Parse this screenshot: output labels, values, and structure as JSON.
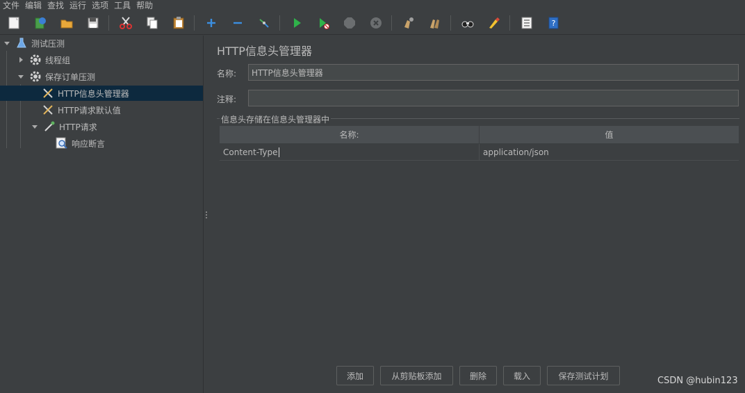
{
  "menu": [
    "文件",
    "编辑",
    "查找",
    "运行",
    "选项",
    "工具",
    "帮助"
  ],
  "toolbar_icons": [
    "new-icon",
    "templates-icon",
    "open-icon",
    "save-icon",
    "cut-icon",
    "copy-icon",
    "paste-icon",
    "expand-icon",
    "collapse-icon",
    "toggle-icon",
    "start-icon",
    "start-no-pause-icon",
    "stop-icon",
    "shutdown-icon",
    "clear-icon",
    "clear-all-icon",
    "search-icon",
    "reset-search-icon",
    "function-helper-icon",
    "help-icon"
  ],
  "tree": {
    "items": [
      {
        "label": "测试压测",
        "icon": "test-plan-flask-icon"
      },
      {
        "label": "线程组",
        "icon": "thread-group-gear-icon"
      },
      {
        "label": "保存订单压测",
        "icon": "thread-group-gear-icon"
      },
      {
        "label": "HTTP信息头管理器",
        "icon": "config-tools-icon"
      },
      {
        "label": "HTTP请求默认值",
        "icon": "config-tools-icon"
      },
      {
        "label": "HTTP请求",
        "icon": "sampler-pipette-icon"
      },
      {
        "label": "响应断言",
        "icon": "assertion-magnifier-icon"
      }
    ]
  },
  "editor": {
    "title": "HTTP信息头管理器",
    "name_label": "名称:",
    "name_value": "HTTP信息头管理器",
    "comment_label": "注释:",
    "comment_value": "",
    "group_title": "信息头存储在信息头管理器中",
    "table": {
      "headers": [
        "名称:",
        "值"
      ],
      "rows": [
        [
          "Content-Type",
          "application/json"
        ]
      ]
    },
    "buttons": [
      "添加",
      "从剪贴板添加",
      "删除",
      "载入",
      "保存测试计划"
    ]
  },
  "watermark": "CSDN @hubin123",
  "colors": {
    "background": "#3c3f41",
    "selection": "#0d293e",
    "text": "#bbbbbb",
    "field_bg": "#45494a",
    "header_bg": "#4b4f52"
  }
}
